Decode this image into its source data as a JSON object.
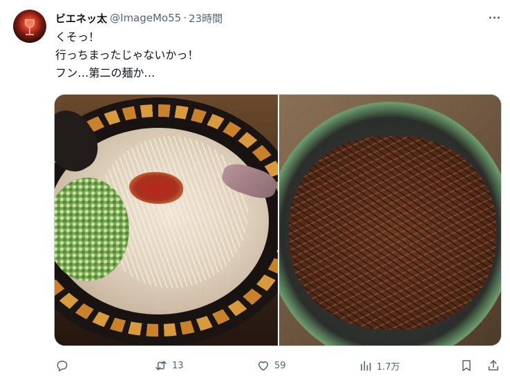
{
  "author": {
    "display_name": "ビエネッ太",
    "handle": "@ImageMo55",
    "separator": "·",
    "time": "23時間"
  },
  "tweet": {
    "lines": [
      "くそっ！",
      "行っちまったじゃないかっ！",
      "フン…第二の麺か…"
    ]
  },
  "actions": {
    "retweets": "13",
    "likes": "59",
    "views": "1.7万"
  },
  "icons": {
    "more": "more-horizontal-icon",
    "reply": "reply-icon",
    "retweet": "retweet-icon",
    "like": "heart-icon",
    "views": "views-chart-icon",
    "bookmark": "bookmark-icon",
    "share": "share-icon"
  },
  "colors": {
    "text_primary": "#0f1419",
    "text_secondary": "#536471",
    "border": "#cfd9de"
  }
}
